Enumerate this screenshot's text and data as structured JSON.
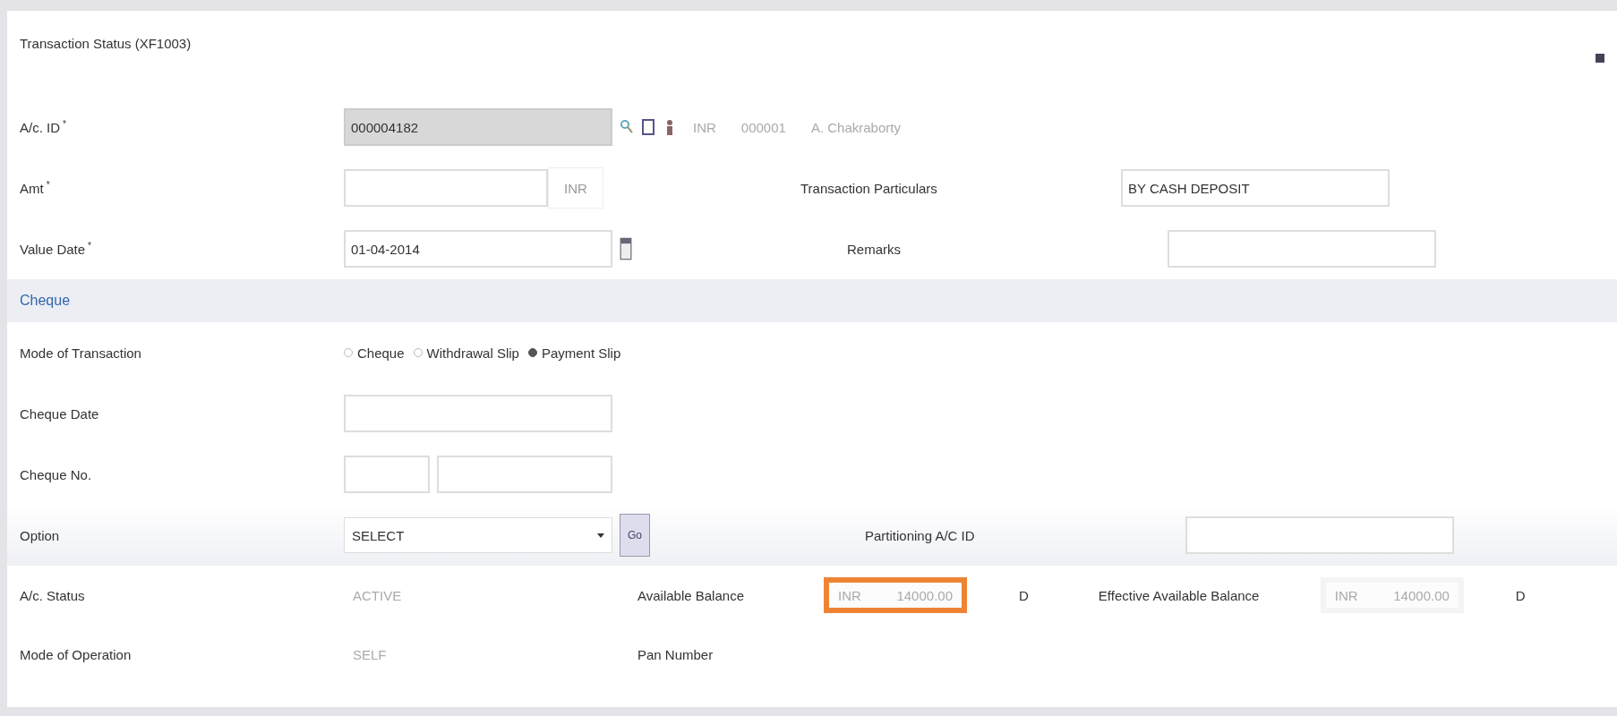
{
  "window": {
    "title": "Transaction Status (XF1003)"
  },
  "form": {
    "account_id": {
      "label": "A/c. ID",
      "required_mark": "*",
      "value": "000004182",
      "currency": "INR",
      "code": "000001",
      "name": "A. Chakraborty"
    },
    "amount": {
      "label": "Amt",
      "required_mark": "*",
      "currency": "INR"
    },
    "value_date": {
      "label": "Value Date",
      "required_mark": "*",
      "value": "01-04-2014"
    },
    "particulars": {
      "label": "Transaction Particulars",
      "value": "BY CASH DEPOSIT"
    },
    "remarks": {
      "label": "Remarks"
    }
  },
  "cheque": {
    "title": "Cheque",
    "mode": {
      "label": "Mode of Transaction",
      "options": [
        {
          "label": "Cheque",
          "selected": false
        },
        {
          "label": "Withdrawal Slip",
          "selected": false
        },
        {
          "label": "Payment Slip",
          "selected": true
        }
      ]
    },
    "cheque_date": {
      "label": "Cheque Date"
    },
    "cheque_no": {
      "label": "Cheque No."
    },
    "option": {
      "label": "Option",
      "value": "SELECT",
      "go": "Go"
    },
    "partitioning": {
      "label": "Partitioning A/C ID"
    }
  },
  "summary": {
    "status": {
      "label": "A/c. Status",
      "value": "ACTIVE"
    },
    "available": {
      "label": "Available Balance",
      "currency": "INR",
      "value": "14000.00",
      "flag": "D",
      "highlighted": true
    },
    "effective": {
      "label": "Effective Available Balance",
      "currency": "INR",
      "value": "14000.00",
      "flag": "D",
      "highlighted": false
    },
    "operation": {
      "label": "Mode of Operation",
      "value": "SELF"
    },
    "pan": {
      "label": "Pan Number"
    }
  }
}
